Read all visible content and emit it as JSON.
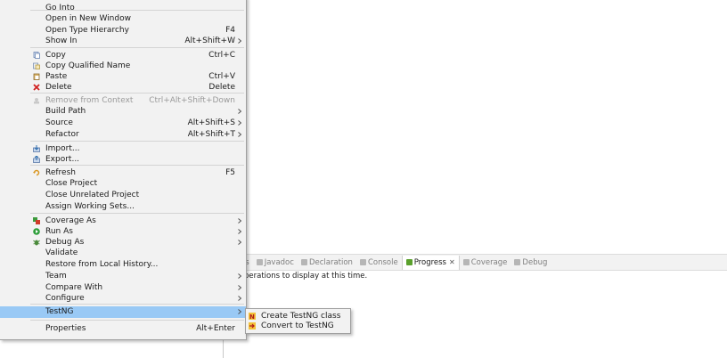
{
  "panel": {
    "tabs": [
      {
        "label": "blems",
        "icon": "problems-icon",
        "active": false
      },
      {
        "label": "Javadoc",
        "icon": "javadoc-icon",
        "active": false
      },
      {
        "label": "Declaration",
        "icon": "declaration-icon",
        "active": false
      },
      {
        "label": "Console",
        "icon": "console-icon",
        "active": false
      },
      {
        "label": "Progress",
        "icon": "progress-icon",
        "active": true,
        "close": "✕"
      },
      {
        "label": "Coverage",
        "icon": "coverage-icon",
        "active": false
      },
      {
        "label": "Debug",
        "icon": "debug-icon",
        "active": false
      }
    ],
    "message": "perations to display at this time."
  },
  "menu": {
    "items": [
      {
        "label": "Go Into",
        "accel": "",
        "submenu": false,
        "icon": "",
        "disabled": false
      },
      {
        "label": "Open in New Window",
        "accel": "",
        "submenu": false,
        "icon": "",
        "disabled": false
      },
      {
        "label": "Open Type Hierarchy",
        "accel": "F4",
        "submenu": false,
        "icon": "",
        "disabled": false
      },
      {
        "label": "Show In",
        "accel": "Alt+Shift+W",
        "submenu": true,
        "icon": "",
        "disabled": false
      },
      {
        "label": "Copy",
        "accel": "Ctrl+C",
        "submenu": false,
        "icon": "copy-icon",
        "disabled": false
      },
      {
        "label": "Copy Qualified Name",
        "accel": "",
        "submenu": false,
        "icon": "copy-qualified-name-icon",
        "disabled": false
      },
      {
        "label": "Paste",
        "accel": "Ctrl+V",
        "submenu": false,
        "icon": "paste-icon",
        "disabled": false
      },
      {
        "label": "Delete",
        "accel": "Delete",
        "submenu": false,
        "icon": "delete-icon",
        "disabled": false
      },
      {
        "label": "Remove from Context",
        "accel": "Ctrl+Alt+Shift+Down",
        "submenu": false,
        "icon": "remove-context-icon",
        "disabled": true
      },
      {
        "label": "Build Path",
        "accel": "",
        "submenu": true,
        "icon": "",
        "disabled": false
      },
      {
        "label": "Source",
        "accel": "Alt+Shift+S",
        "submenu": true,
        "icon": "",
        "disabled": false
      },
      {
        "label": "Refactor",
        "accel": "Alt+Shift+T",
        "submenu": true,
        "icon": "",
        "disabled": false
      },
      {
        "label": "Import...",
        "accel": "",
        "submenu": false,
        "icon": "import-icon",
        "disabled": false
      },
      {
        "label": "Export...",
        "accel": "",
        "submenu": false,
        "icon": "export-icon",
        "disabled": false
      },
      {
        "label": "Refresh",
        "accel": "F5",
        "submenu": false,
        "icon": "refresh-icon",
        "disabled": false
      },
      {
        "label": "Close Project",
        "accel": "",
        "submenu": false,
        "icon": "",
        "disabled": false
      },
      {
        "label": "Close Unrelated Project",
        "accel": "",
        "submenu": false,
        "icon": "",
        "disabled": false
      },
      {
        "label": "Assign Working Sets...",
        "accel": "",
        "submenu": false,
        "icon": "",
        "disabled": false
      },
      {
        "label": "Coverage As",
        "accel": "",
        "submenu": true,
        "icon": "coverage-as-icon",
        "disabled": false
      },
      {
        "label": "Run As",
        "accel": "",
        "submenu": true,
        "icon": "run-as-icon",
        "disabled": false
      },
      {
        "label": "Debug As",
        "accel": "",
        "submenu": true,
        "icon": "debug-as-icon",
        "disabled": false
      },
      {
        "label": "Validate",
        "accel": "",
        "submenu": false,
        "icon": "",
        "disabled": false
      },
      {
        "label": "Restore from Local History...",
        "accel": "",
        "submenu": false,
        "icon": "",
        "disabled": false
      },
      {
        "label": "Team",
        "accel": "",
        "submenu": true,
        "icon": "",
        "disabled": false
      },
      {
        "label": "Compare With",
        "accel": "",
        "submenu": true,
        "icon": "",
        "disabled": false
      },
      {
        "label": "Configure",
        "accel": "",
        "submenu": true,
        "icon": "",
        "disabled": false
      },
      {
        "label": "TestNG",
        "accel": "",
        "submenu": true,
        "icon": "",
        "disabled": false,
        "selected": true
      },
      {
        "label": "Properties",
        "accel": "Alt+Enter",
        "submenu": false,
        "icon": "",
        "disabled": false
      }
    ]
  },
  "submenu": {
    "items": [
      {
        "label": "Create TestNG class",
        "icon": "create-testng-class-icon"
      },
      {
        "label": "Convert to TestNG",
        "icon": "convert-to-testng-icon"
      }
    ]
  },
  "colors": {
    "menu_bg": "#f2f2f2",
    "selected": "#99c9f5",
    "disabled_text": "#9a9a9a",
    "delete_icon": "#d02020",
    "run_icon": "#2e9e3a"
  }
}
